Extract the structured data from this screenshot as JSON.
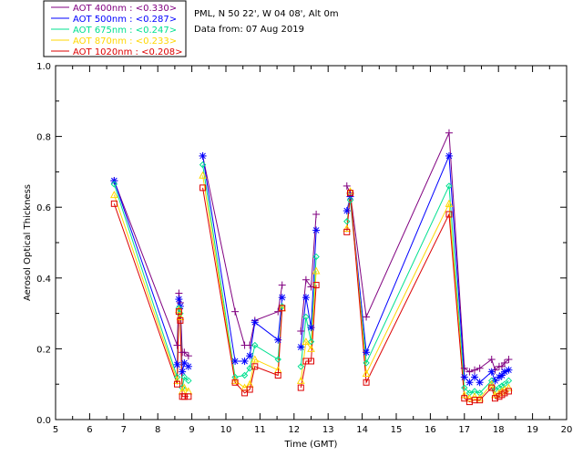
{
  "header": {
    "location": "PML, N 50 22', W 04 08', Alt 0m",
    "data_from": "Data from: 07 Aug 2019"
  },
  "legend": [
    {
      "label": "AOT  400nm : <0.330>",
      "color": "#800080"
    },
    {
      "label": "AOT  500nm : <0.287>",
      "color": "#0000ff"
    },
    {
      "label": "AOT  675nm : <0.247>",
      "color": "#00e090"
    },
    {
      "label": "AOT  870nm : <0.233>",
      "color": "#ffd700"
    },
    {
      "label": "AOT 1020nm : <0.208>",
      "color": "#dd0000"
    }
  ],
  "chart_data": {
    "type": "scatter",
    "xlabel": "Time (GMT)",
    "ylabel": "Aerosol Optical Thickness",
    "xlim": [
      5,
      20
    ],
    "ylim": [
      0,
      1.0
    ],
    "xticks": [
      "5",
      "6",
      "7",
      "8",
      "9",
      "10",
      "11",
      "12",
      "13",
      "14",
      "15",
      "16",
      "17",
      "18",
      "19",
      "20"
    ],
    "yticks": [
      "0.0",
      "0.2",
      "0.4",
      "0.6",
      "0.8",
      "1.0"
    ],
    "x": [
      6.72,
      8.57,
      8.62,
      8.66,
      8.72,
      8.78,
      8.9,
      9.0,
      9.32,
      10.27,
      10.55,
      10.7,
      10.85,
      11.53,
      11.65,
      11.75,
      12.2,
      12.35,
      12.5,
      12.65,
      12.72,
      13.55,
      13.65,
      14.12,
      16.55,
      17.0,
      17.15,
      17.3,
      17.45,
      17.8,
      17.9,
      18.02,
      18.1,
      18.18,
      18.3
    ],
    "series": [
      {
        "name": "AOT  400nm : <0.330>",
        "marker": "plus",
        "connected": true,
        "values": [
          0.675,
          0.21,
          0.357,
          0.33,
          0.19,
          0.19,
          0.18,
          null,
          0.745,
          0.305,
          0.21,
          0.21,
          0.28,
          0.305,
          0.38,
          null,
          0.25,
          0.395,
          0.375,
          0.58,
          null,
          0.66,
          0.64,
          0.29,
          0.81,
          0.145,
          0.135,
          0.14,
          0.145,
          0.17,
          0.14,
          0.15,
          0.15,
          0.16,
          0.17
        ]
      },
      {
        "name": "AOT  500nm : <0.287>",
        "marker": "asterisk",
        "connected": true,
        "values": [
          0.675,
          0.155,
          0.34,
          0.32,
          0.135,
          0.16,
          0.15,
          null,
          0.745,
          0.165,
          0.165,
          0.18,
          0.275,
          0.225,
          0.345,
          null,
          0.205,
          0.345,
          0.26,
          0.535,
          null,
          0.59,
          0.63,
          0.19,
          0.745,
          0.12,
          0.105,
          0.12,
          0.105,
          0.135,
          0.11,
          0.12,
          0.125,
          0.135,
          0.14
        ]
      },
      {
        "name": "AOT  675nm : <0.247>",
        "marker": "diamond",
        "connected": true,
        "values": [
          0.665,
          0.12,
          0.315,
          0.3,
          0.09,
          0.12,
          0.11,
          null,
          0.72,
          0.12,
          0.125,
          0.145,
          0.21,
          0.17,
          0.32,
          null,
          0.15,
          0.29,
          0.22,
          0.46,
          null,
          0.56,
          0.62,
          0.16,
          0.66,
          0.09,
          0.075,
          0.08,
          0.075,
          0.11,
          0.085,
          0.09,
          0.095,
          0.1,
          0.11
        ]
      },
      {
        "name": "AOT  870nm : <0.233>",
        "marker": "triangle",
        "connected": true,
        "values": [
          0.635,
          0.11,
          0.31,
          0.29,
          0.08,
          0.09,
          0.08,
          null,
          0.69,
          0.11,
          0.09,
          0.1,
          0.17,
          0.14,
          0.315,
          null,
          0.11,
          0.22,
          0.2,
          0.42,
          null,
          0.54,
          0.645,
          0.13,
          0.61,
          0.07,
          0.06,
          0.065,
          0.06,
          0.1,
          0.07,
          0.075,
          0.08,
          0.085,
          0.09
        ]
      },
      {
        "name": "AOT 1020nm : <0.208>",
        "marker": "square",
        "connected": true,
        "values": [
          0.61,
          0.1,
          0.305,
          0.28,
          0.065,
          0.065,
          0.065,
          null,
          0.655,
          0.105,
          0.075,
          0.085,
          0.15,
          0.125,
          0.315,
          null,
          0.09,
          0.165,
          0.165,
          0.38,
          null,
          0.53,
          0.64,
          0.105,
          0.58,
          0.06,
          0.05,
          0.055,
          0.055,
          0.09,
          0.06,
          0.065,
          0.07,
          0.075,
          0.08
        ]
      }
    ]
  }
}
